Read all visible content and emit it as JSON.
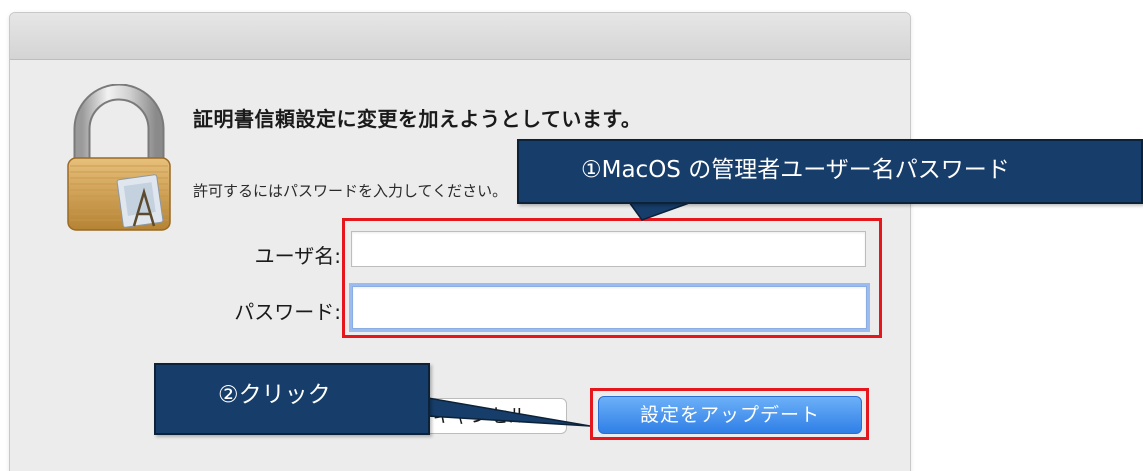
{
  "dialog": {
    "title": "証明書信頼設定に変更を加えようとしています。",
    "message": "許可するにはパスワードを入力してください。",
    "username_label": "ユーザ名:",
    "password_label": "パスワード:",
    "username_value": "",
    "password_value": "",
    "cancel_label": "キャンセル",
    "update_label": "設定をアップデート",
    "lock_icon": "padlock-icon"
  },
  "annotations": {
    "callout_1": "①MacOS の管理者ユーザー名パスワード",
    "callout_2": "②クリック"
  },
  "colors": {
    "highlight_box": "#e5161c",
    "callout_fill": "#173e6b",
    "primary_button": "#3b8cf0"
  }
}
